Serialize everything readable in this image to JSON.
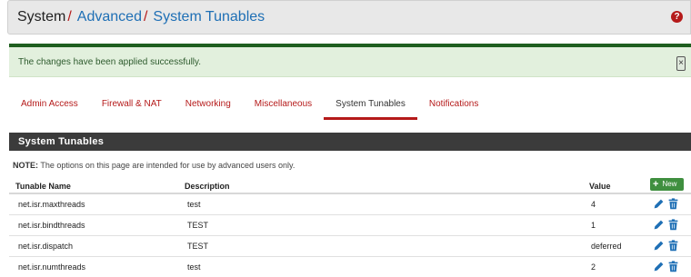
{
  "breadcrumb": {
    "root": "System",
    "sep": "/",
    "items": [
      "Advanced",
      "System Tunables"
    ]
  },
  "alert": {
    "message": "The changes have been applied successfully.",
    "close_symbol": "×"
  },
  "tabs": [
    {
      "label": "Admin Access"
    },
    {
      "label": "Firewall & NAT"
    },
    {
      "label": "Networking"
    },
    {
      "label": "Miscellaneous"
    },
    {
      "label": "System Tunables",
      "active": true
    },
    {
      "label": "Notifications"
    }
  ],
  "panel": {
    "title": "System Tunables",
    "note_label": "NOTE:",
    "note_text": " The options on this page are intended for use by advanced users only.",
    "columns": [
      "Tunable Name",
      "Description",
      "Value"
    ],
    "new_button": "New",
    "rows": [
      {
        "name": "net.isr.maxthreads",
        "description": "test",
        "value": "4"
      },
      {
        "name": "net.isr.bindthreads",
        "description": "TEST",
        "value": "1"
      },
      {
        "name": "net.isr.dispatch",
        "description": "TEST",
        "value": "deferred"
      },
      {
        "name": "net.isr.numthreads",
        "description": "test",
        "value": "2"
      }
    ]
  },
  "colors": {
    "accent_red": "#b51a1a",
    "link_blue": "#1e6fb5",
    "success_green": "#3f8f3f",
    "panel_dark": "#3b3b3b"
  }
}
